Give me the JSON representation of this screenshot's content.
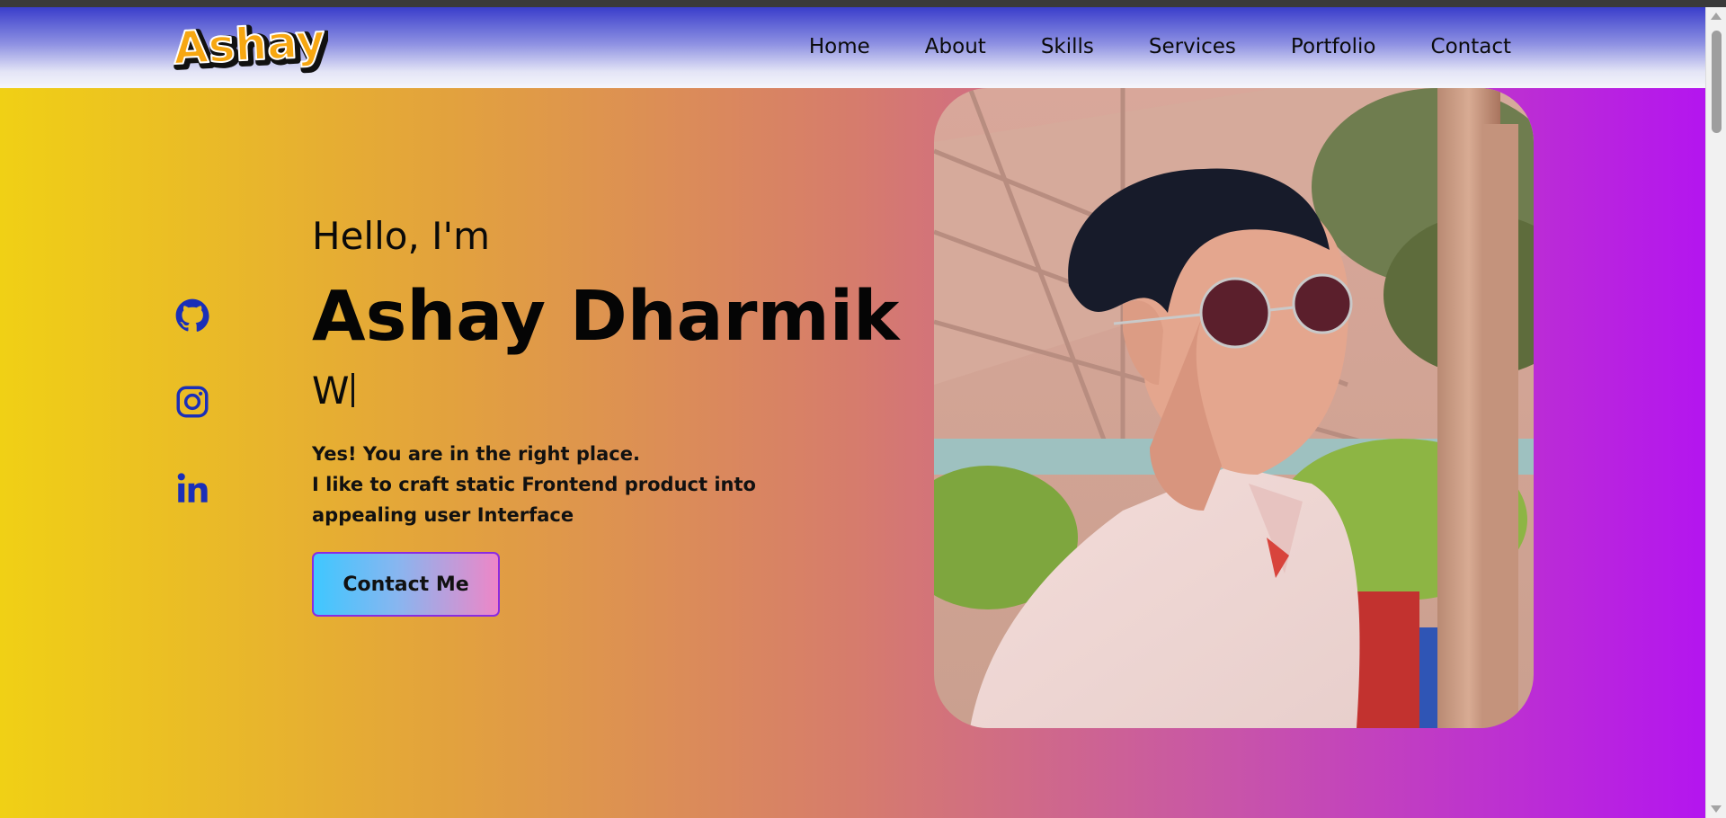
{
  "logo": {
    "text": "Ashay"
  },
  "nav": {
    "items": [
      {
        "label": "Home"
      },
      {
        "label": "About"
      },
      {
        "label": "Skills"
      },
      {
        "label": "Services"
      },
      {
        "label": "Portfolio"
      },
      {
        "label": "Contact"
      }
    ]
  },
  "socials": {
    "items": [
      {
        "name": "github-icon"
      },
      {
        "name": "instagram-icon"
      },
      {
        "name": "linkedin-icon"
      }
    ],
    "icon_color": "#1a2fb8"
  },
  "hero": {
    "greeting": "Hello, I'm",
    "name": "Ashay Dharmik",
    "typed_text": "W",
    "description_lines": [
      "Yes! You are in the right place.",
      "I like to craft static Frontend product into",
      "appealing user Interface"
    ],
    "cta_label": "Contact Me"
  },
  "colors": {
    "hero_gradient": [
      "#f0d015",
      "#e3a43b",
      "#d67c6c",
      "#c855a8",
      "#b415ef"
    ],
    "nav_gradient_top": "#3a3ecb",
    "button_gradient": [
      "#3fc7ff",
      "#ee86c7"
    ]
  }
}
